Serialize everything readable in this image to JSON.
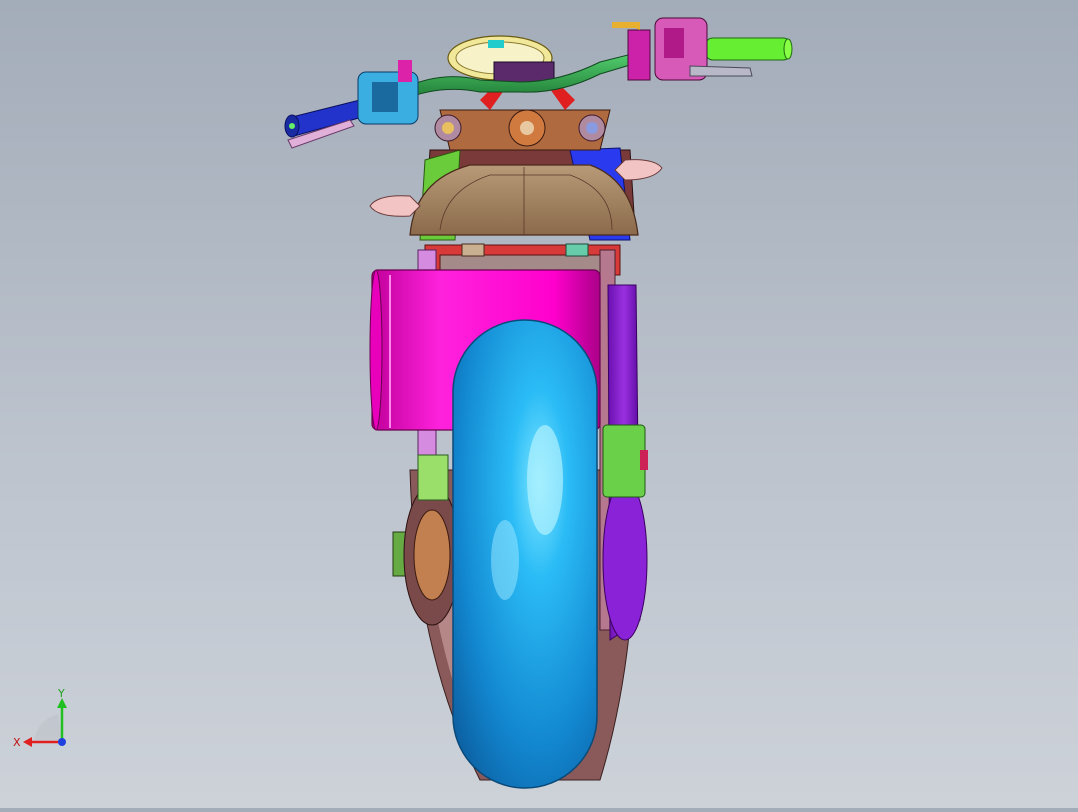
{
  "viewport": {
    "model_icon": "motorcycle-rear-view-3d-model"
  },
  "triad": {
    "x_label": "X",
    "y_label": "Y",
    "x_color": "#e02020",
    "y_color": "#20c020",
    "z_color": "#2040e0"
  },
  "colors": {
    "tire": "#1aa4ee",
    "swingarm_box": "#ff00cc",
    "handlebar": "#2ea24a",
    "grip_right": "#66ee33",
    "grip_left": "#2233cc",
    "seat": "#9a7a5a",
    "exhaust_side": "#8822cc"
  }
}
